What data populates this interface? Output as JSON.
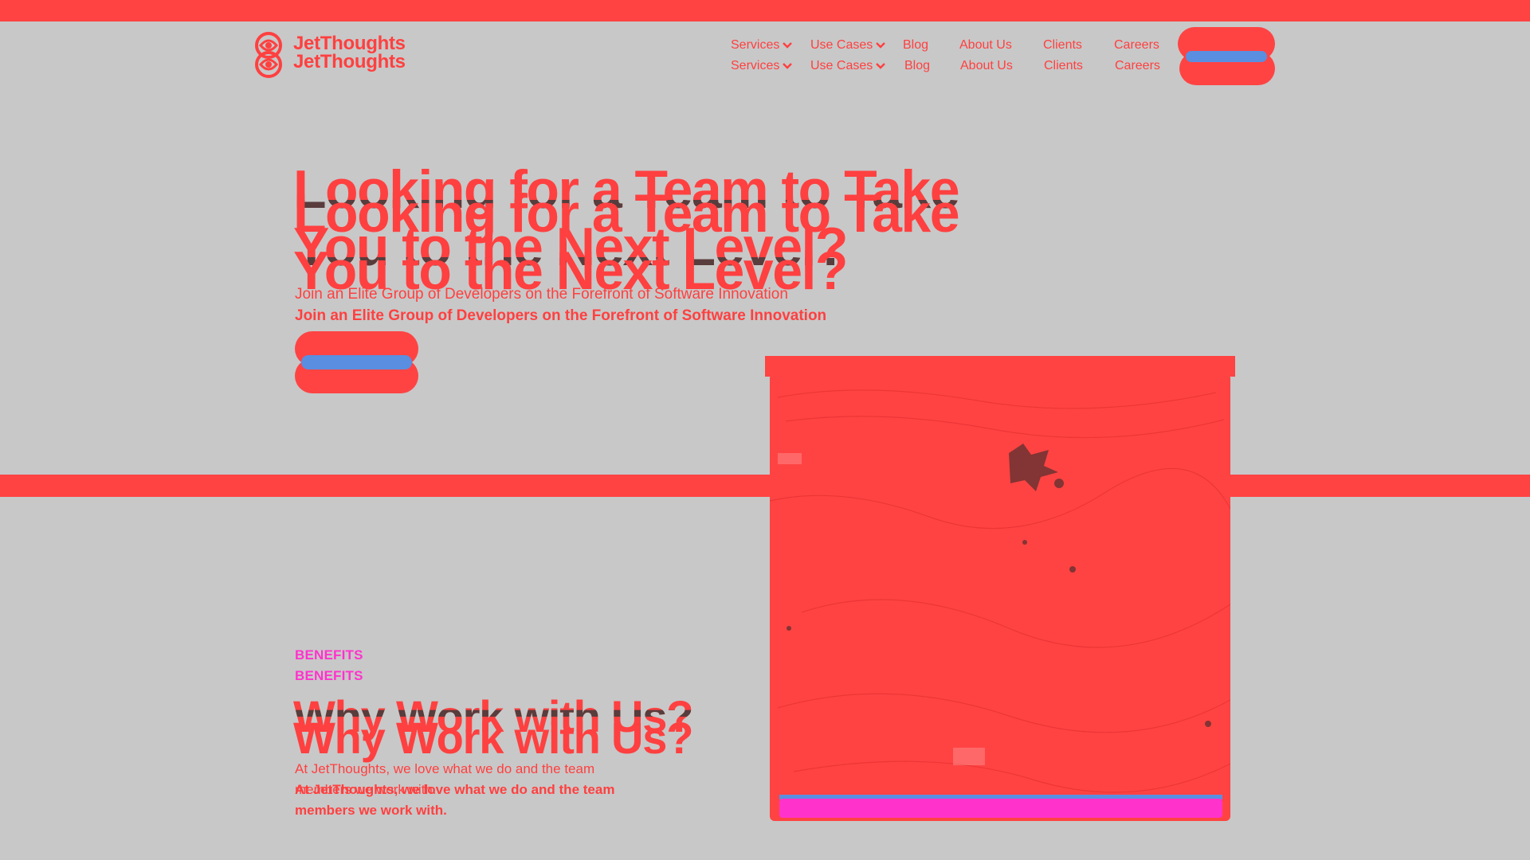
{
  "brand": {
    "name": "JetThoughts",
    "accent_color": "#ff4343",
    "highlight_color": "#ff33cc",
    "button_color": "#5a8ee0",
    "logo_icon": "jetthoughts-logo-icon"
  },
  "nav": {
    "items": [
      {
        "label": "Services",
        "has_dropdown": true
      },
      {
        "label": "Use Cases",
        "has_dropdown": true
      },
      {
        "label": "Blog"
      },
      {
        "label": "About Us"
      },
      {
        "label": "Clients"
      },
      {
        "label": "Careers"
      }
    ],
    "dropdown_icon": "chevron-down-icon"
  },
  "hero": {
    "title_line1": "Looking for a Team to Take",
    "title_line2": "You to the Next Level?",
    "subtitle": "Join an Elite Group of Developers on the Forefront of Software Innovation"
  },
  "benefits": {
    "eyebrow": "BENEFITS",
    "heading": "Why Work with Us?",
    "text": "At JetThoughts, we love what we do and the team members we work with."
  }
}
